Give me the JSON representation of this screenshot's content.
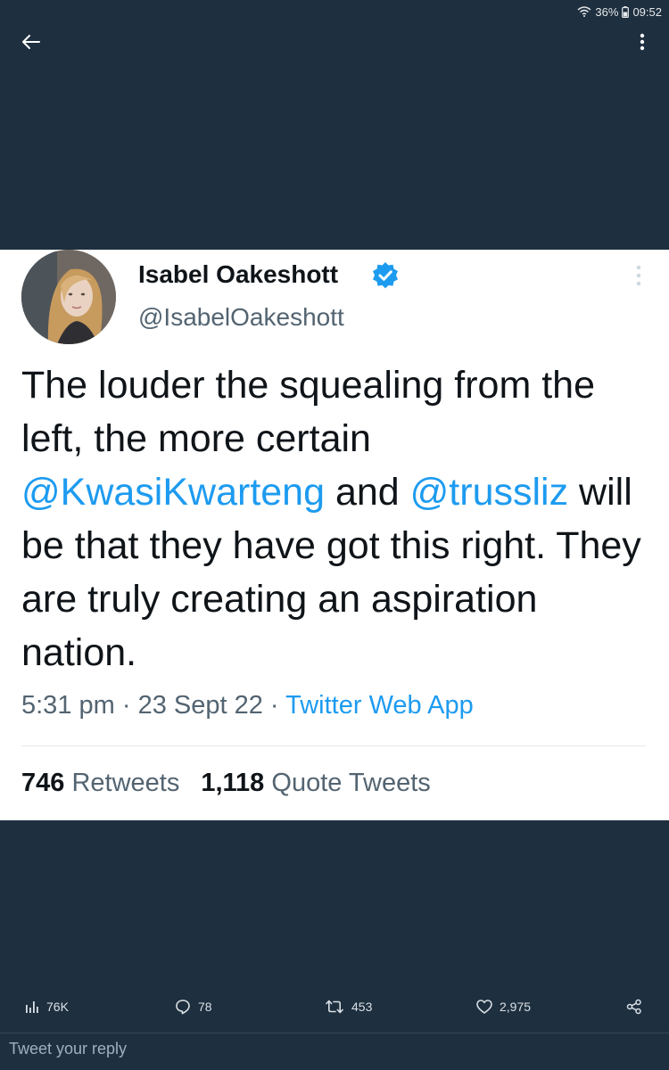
{
  "status_bar": {
    "battery": "36%",
    "time": "09:52"
  },
  "tweet": {
    "author_name": "Isabel Oakeshott",
    "handle": "@IsabelOakeshott",
    "text_segments": {
      "t1": "The louder the squealing from the left, the more certain ",
      "m1": "@KwasiKwarteng",
      "t2": " and ",
      "m2": "@trussliz",
      "t3": " will be that they have got this right. They are truly creating an aspiration nation."
    },
    "time": "5:31 pm",
    "date": "23 Sept 22",
    "source": "Twitter Web App",
    "sep": " · ",
    "retweets_count": "746",
    "retweets_label": "Retweets",
    "quotes_count": "1,118",
    "quotes_label": "Quote Tweets"
  },
  "actions": {
    "views": "76K",
    "replies": "78",
    "retweets": "453",
    "likes": "2,975"
  },
  "reply": {
    "placeholder": "Tweet your reply"
  },
  "icons": {
    "back": "arrow-left-icon",
    "more": "more-vertical-icon",
    "verified": "verified-badge-icon",
    "views": "bar-chart-icon",
    "reply": "speech-bubble-icon",
    "retweet": "retweet-icon",
    "like": "heart-icon",
    "share": "share-icon"
  },
  "colors": {
    "background": "#1e2f3f",
    "accent": "#1d9bf0",
    "text": "#0f1419",
    "muted": "#536471"
  }
}
